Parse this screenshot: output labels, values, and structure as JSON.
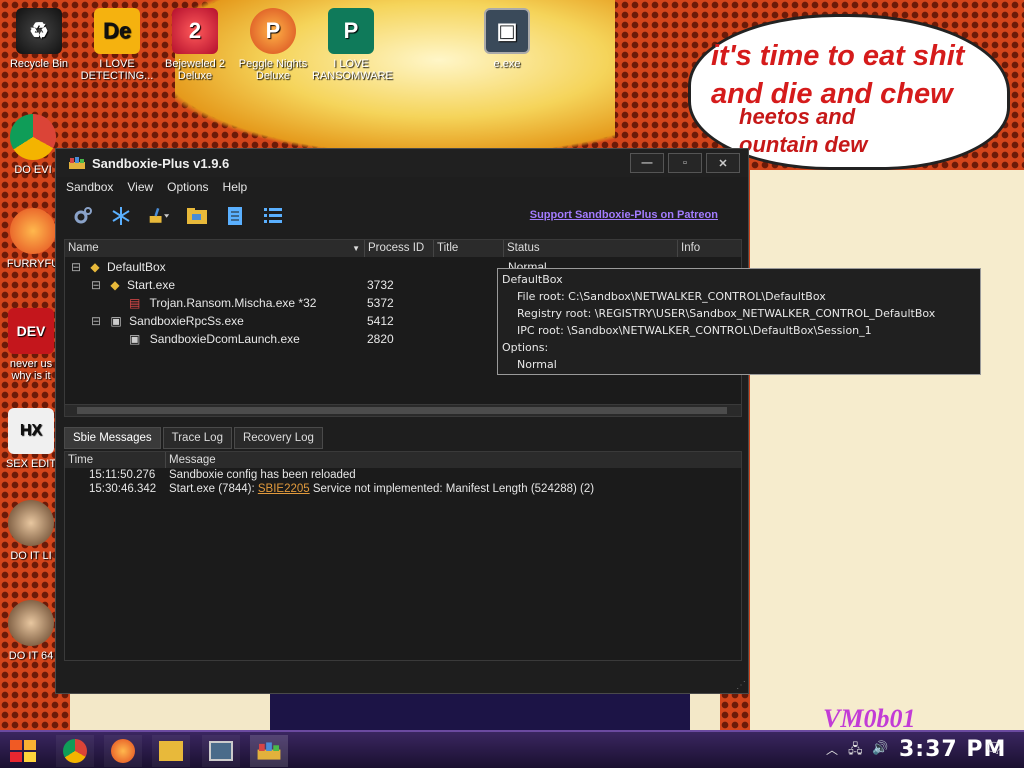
{
  "wallpaper": {
    "speech_line1": "it's time to eat shit",
    "speech_line2": "and die and chew",
    "speech_overlay1": "heetos and",
    "speech_overlay2": "ountain dew",
    "vm_label": "VM0b01"
  },
  "desktop_icons": [
    {
      "label": "Recycle Bin",
      "icon": "recycle-bin-icon"
    },
    {
      "label": "I LOVE DETECTING...",
      "icon": "de-app-icon"
    },
    {
      "label": "Bejeweled 2 Deluxe",
      "icon": "bejeweled-icon"
    },
    {
      "label": "Peggle Nights Deluxe",
      "icon": "peggle-icon"
    },
    {
      "label": "I LOVE RANSOMWARE",
      "icon": "publisher-icon"
    },
    {
      "label": "e.exe",
      "icon": "exe-icon"
    },
    {
      "label": "DO EVI",
      "icon": "chrome-icon"
    },
    {
      "label": "FURRYFU",
      "icon": "firefox-icon"
    },
    {
      "label": "never us why is it",
      "icon": "devcpp-icon"
    },
    {
      "label": "SEX EDIT",
      "icon": "hxd-icon"
    },
    {
      "label": "DO IT LI",
      "icon": "portrait-icon"
    },
    {
      "label": "DO IT 64",
      "icon": "portrait-64-icon"
    }
  ],
  "window": {
    "title": "Sandboxie-Plus v1.9.6",
    "menu": [
      "Sandbox",
      "View",
      "Options",
      "Help"
    ],
    "patreon_link": "Support Sandboxie-Plus on Patreon",
    "tree_columns": [
      "Name",
      "Process ID",
      "Title",
      "Status",
      "Info"
    ],
    "tree_rows": [
      {
        "name": "DefaultBox",
        "pid": "",
        "status": "Normal",
        "icon": "sandbox-icon"
      },
      {
        "name": "Start.exe",
        "pid": "3732",
        "icon": "start-exe-icon"
      },
      {
        "name": "Trojan.Ransom.Mischa.exe *32",
        "pid": "5372",
        "icon": "pdf-exe-icon"
      },
      {
        "name": "SandboxieRpcSs.exe",
        "pid": "5412",
        "icon": "service-icon"
      },
      {
        "name": "SandboxieDcomLaunch.exe",
        "pid": "2820",
        "icon": "service-icon"
      }
    ],
    "tabs": [
      "Sbie Messages",
      "Trace Log",
      "Recovery Log"
    ],
    "log_columns": [
      "Time",
      "Message"
    ],
    "log_rows": [
      {
        "time": "15:11:50.276",
        "message": "Sandboxie config has been reloaded"
      },
      {
        "time": "15:30:46.342",
        "prefix": "Start.exe (7844): ",
        "code": "SBIE2205",
        "message": " Service not implemented: Manifest Length (524288) (2)"
      }
    ]
  },
  "tooltip": {
    "title": "DefaultBox",
    "file_root": "File root: C:\\Sandbox\\NETWALKER_CONTROL\\DefaultBox",
    "registry_root": "Registry root: \\REGISTRY\\USER\\Sandbox_NETWALKER_CONTROL_DefaultBox",
    "ipc_root": "IPC root: \\Sandbox\\NETWALKER_CONTROL\\DefaultBox\\Session_1",
    "options_label": "Options:",
    "options_value": "Normal"
  },
  "taskbar": {
    "time": "3:37 PM",
    "apps": [
      "chrome-icon",
      "firefox-icon",
      "file-explorer-icon",
      "remote-desktop-icon",
      "sandboxie-icon"
    ]
  },
  "colors": {
    "accent_link": "#a37cff",
    "sbie_code": "#e29a3c",
    "speech_text": "#d51b1b"
  }
}
